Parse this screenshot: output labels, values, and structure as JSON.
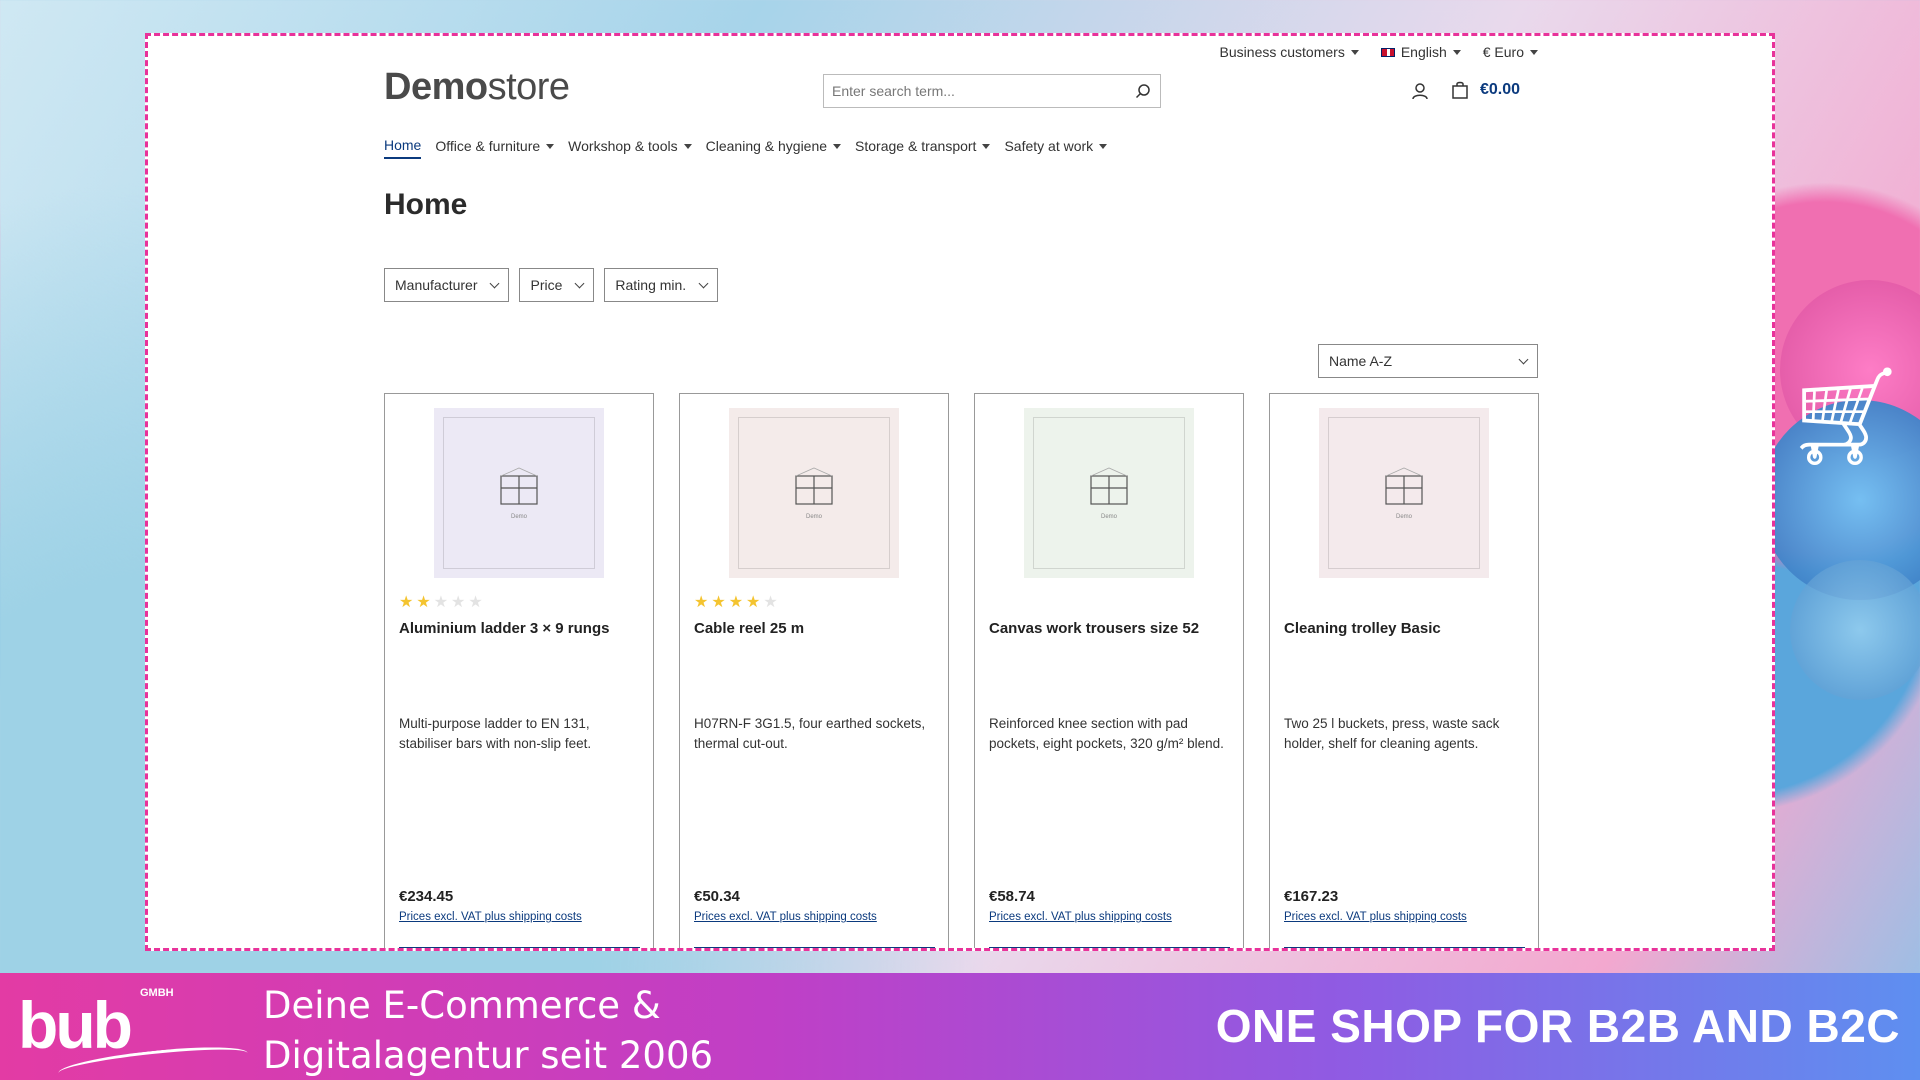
{
  "topbar": {
    "business": "Business customers",
    "language": "English",
    "currency": "€ Euro"
  },
  "logo": {
    "bold": "Demo",
    "light": "store"
  },
  "search": {
    "placeholder": "Enter search term..."
  },
  "cart": {
    "total": "€0.00"
  },
  "nav": {
    "items": [
      {
        "label": "Home",
        "active": true
      },
      {
        "label": "Office & furniture"
      },
      {
        "label": "Workshop & tools"
      },
      {
        "label": "Cleaning & hygiene"
      },
      {
        "label": "Storage & transport"
      },
      {
        "label": "Safety at work"
      }
    ]
  },
  "page": {
    "title": "Home"
  },
  "filters": {
    "manufacturer": "Manufacturer",
    "price": "Price",
    "rating": "Rating min."
  },
  "sort": {
    "selected": "Name A-Z"
  },
  "thumb_label": "Demo",
  "products": [
    {
      "name": "Aluminium ladder 3 × 9 rungs",
      "rating": 2,
      "description": "Multi-purpose ladder to EN 131, stabiliser bars with non-slip feet.",
      "price": "€234.45",
      "vat": "Prices excl. VAT plus shipping costs",
      "thumb_color": "#ece9f5"
    },
    {
      "name": "Cable reel 25 m",
      "rating": 4,
      "description": "H07RN-F 3G1.5, four earthed sockets, thermal cut-out.",
      "price": "€50.34",
      "vat": "Prices excl. VAT plus shipping costs",
      "thumb_color": "#f4ebea"
    },
    {
      "name": "Canvas work trousers size 52",
      "rating": 0,
      "description": "Reinforced knee section with pad pockets, eight pockets, 320 g/m² blend.",
      "price": "€58.74",
      "vat": "Prices excl. VAT plus shipping costs",
      "thumb_color": "#edf3ec"
    },
    {
      "name": "Cleaning trolley Basic",
      "rating": 0,
      "description": "Two 25 l buckets, press, waste sack holder, shelf for cleaning agents.",
      "price": "€167.23",
      "vat": "Prices excl. VAT plus shipping costs",
      "thumb_color": "#f4eaec"
    }
  ],
  "banner": {
    "logo_text": "bub",
    "logo_gmbh": "GMBH",
    "tagline_line1": "Deine E-Commerce &",
    "tagline_line2": "Digitalagentur seit 2006",
    "headline": "ONE SHOP FOR B2B AND B2C"
  },
  "colors": {
    "accent": "#0b3a7e",
    "frame_border": "#e8329a",
    "star": "#f4c430"
  }
}
